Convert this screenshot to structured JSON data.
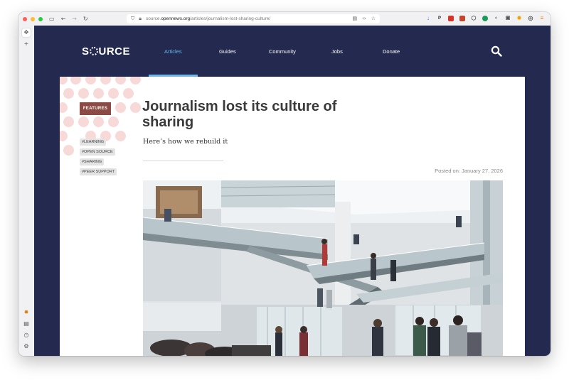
{
  "browser": {
    "url_prefix": "source.",
    "url_domain": "opennews.org",
    "url_path": "/articles/journalism-lost-sharing-culture/"
  },
  "site": {
    "logo": "S  URCE",
    "nav": [
      "Articles",
      "Guides",
      "Community",
      "Jobs",
      "Donate"
    ],
    "active_nav": "Articles"
  },
  "article": {
    "category": "FEATURES",
    "tags": [
      "#LEARNING",
      "#OPEN SOURCE",
      "#SHARING",
      "#PEER SUPPORT"
    ],
    "title": "Journalism lost its culture of sharing",
    "subtitle": "Here’s how we rebuild it",
    "posted": "Posted on: January 27, 2026"
  },
  "colors": {
    "nav_background": "#24294f",
    "accent": "#5db9ee",
    "features_badge": "#8b4a44",
    "dot_pattern": "#f7d9d8"
  }
}
